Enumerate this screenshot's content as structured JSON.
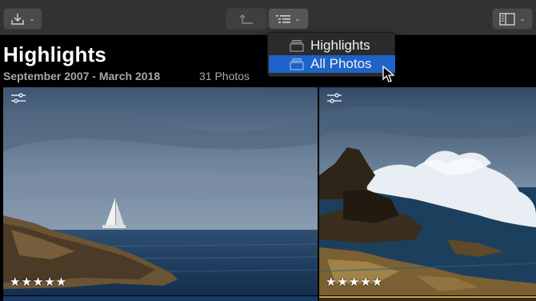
{
  "toolbar": {
    "import_icon": "download-tray-icon",
    "back_icon": "back-arrow-icon",
    "view_icon": "list-filter-icon",
    "sidebar_icon": "sidebar-panel-icon"
  },
  "header": {
    "title": "Highlights",
    "date_range": "September 2007 - March 2018",
    "photo_count": "31 Photos"
  },
  "view_menu": {
    "items": [
      {
        "label": "Highlights",
        "selected": false
      },
      {
        "label": "All Photos",
        "selected": true
      }
    ],
    "highlight_color": "#1d63c9"
  },
  "photos": [
    {
      "subject": "sailboat-on-sea",
      "rating": "★★★★★"
    },
    {
      "subject": "waves-on-rocks",
      "rating": "★★★★★"
    }
  ]
}
